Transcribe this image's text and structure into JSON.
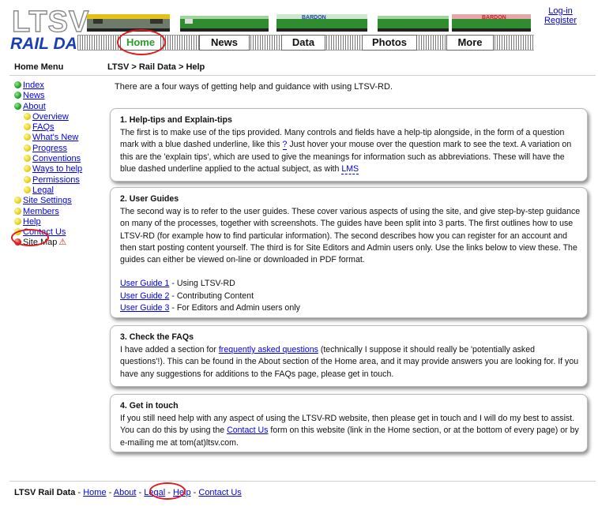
{
  "header": {
    "logo_text": "LTSV",
    "logo_subtitle": "RAIL DATA",
    "train_labels": [
      "BARDON",
      "BARDON"
    ],
    "nav_tabs": [
      "Home",
      "News",
      "Data",
      "Photos",
      "More"
    ],
    "login": "Log-in",
    "register": "Register"
  },
  "menu": {
    "title": "Home Menu",
    "items": [
      {
        "label": "Index",
        "color": "green",
        "link": true
      },
      {
        "label": "News",
        "color": "green",
        "link": true
      },
      {
        "label": "About",
        "color": "green",
        "link": true
      },
      {
        "label": "Overview",
        "color": "yellow",
        "link": true,
        "sub": true
      },
      {
        "label": "FAQs",
        "color": "yellow",
        "link": true,
        "sub": true
      },
      {
        "label": "What's New",
        "color": "yellow",
        "link": true,
        "sub": true
      },
      {
        "label": "Progress",
        "color": "yellow",
        "link": true,
        "sub": true
      },
      {
        "label": "Conventions",
        "color": "yellow",
        "link": true,
        "sub": true
      },
      {
        "label": "Ways to help",
        "color": "yellow",
        "link": true,
        "sub": true
      },
      {
        "label": "Permissions",
        "color": "yellow",
        "link": true,
        "sub": true
      },
      {
        "label": "Legal",
        "color": "yellow",
        "link": true,
        "sub": true
      },
      {
        "label": "Site Settings",
        "color": "yellow",
        "link": true
      },
      {
        "label": "Members",
        "color": "yellow",
        "link": true
      },
      {
        "label": "Help",
        "color": "yellow",
        "link": true
      },
      {
        "label": "Contact Us",
        "color": "yellow",
        "link": true
      },
      {
        "label": "Site Map",
        "color": "red",
        "link": false,
        "warn": true
      }
    ]
  },
  "main": {
    "breadcrumb": "LTSV > Rail Data > Help",
    "intro": "There are a four ways of getting help and guidance with using LTSV-RD.",
    "box1": {
      "heading": "1. Help-tips and Explain-tips",
      "text_a": "The first is to make use of the tips provided. Many controls and fields have a help-tip alongside, in the form of a question mark with a blue dashed underline, like this ",
      "tip": "?",
      "text_b": " Just hover your mouse over the question mark to see the text. A variation on this are the 'explain tips', which are used to give the meanings for information such as abbreviations. These will have the blue dashed underline applied to the actual subject, as with ",
      "explain": "LMS"
    },
    "box2": {
      "heading": "2. User Guides",
      "text": "The second way is to refer to the user guides. These cover various aspects of using the site, and give step-by-step guidance on many of the processes, together with screenshots. The guides have been split into 3 parts. The first outlines how to use LTSV-RD (for example how to find particular information). The second describes how you can register for an account and then start posting content yourself. The third is for Site Editors and Admin users only. Use the links below to view these. The guides can either be viewed on-line or downloaded in PDF format.",
      "guides": [
        {
          "link": "User Guide 1",
          "desc": " - Using LTSV-RD"
        },
        {
          "link": "User Guide 2",
          "desc": " - Contributing Content"
        },
        {
          "link": "User Guide 3",
          "desc": " - For Editors and Admin users only"
        }
      ]
    },
    "box3": {
      "heading": "3. Check the FAQs",
      "text_a": "I have added a section for ",
      "link": "frequently asked questions",
      "text_b": " (technically I suppose it should really be 'potentially asked questions'!). This can be found in the About section of the Home area, and it may provide answers you are looking for. If you have any suggestions for additions to the FAQs page, please get in touch."
    },
    "box4": {
      "heading": "4. Get in touch",
      "text_a": "If you still need help with any aspect of using the LTSV-RD website, then please get in touch and I will do my best to assist. You can do this by using the ",
      "link": "Contact Us",
      "text_b": " form on this website (link in the Home section, or at the bottom of every page) or by e-mailing me at tom(at)ltsv.com."
    }
  },
  "footer": {
    "site": "LTSV Rail Data",
    "sep": " - ",
    "links": [
      "Home",
      "About",
      "Legal",
      "Help",
      "Contact Us"
    ]
  },
  "colors": {
    "accent_green": "#2a9d2a",
    "link_blue": "#0000ee",
    "highlight_red": "#e01b1b",
    "logo_blue": "#1a3fb3"
  }
}
